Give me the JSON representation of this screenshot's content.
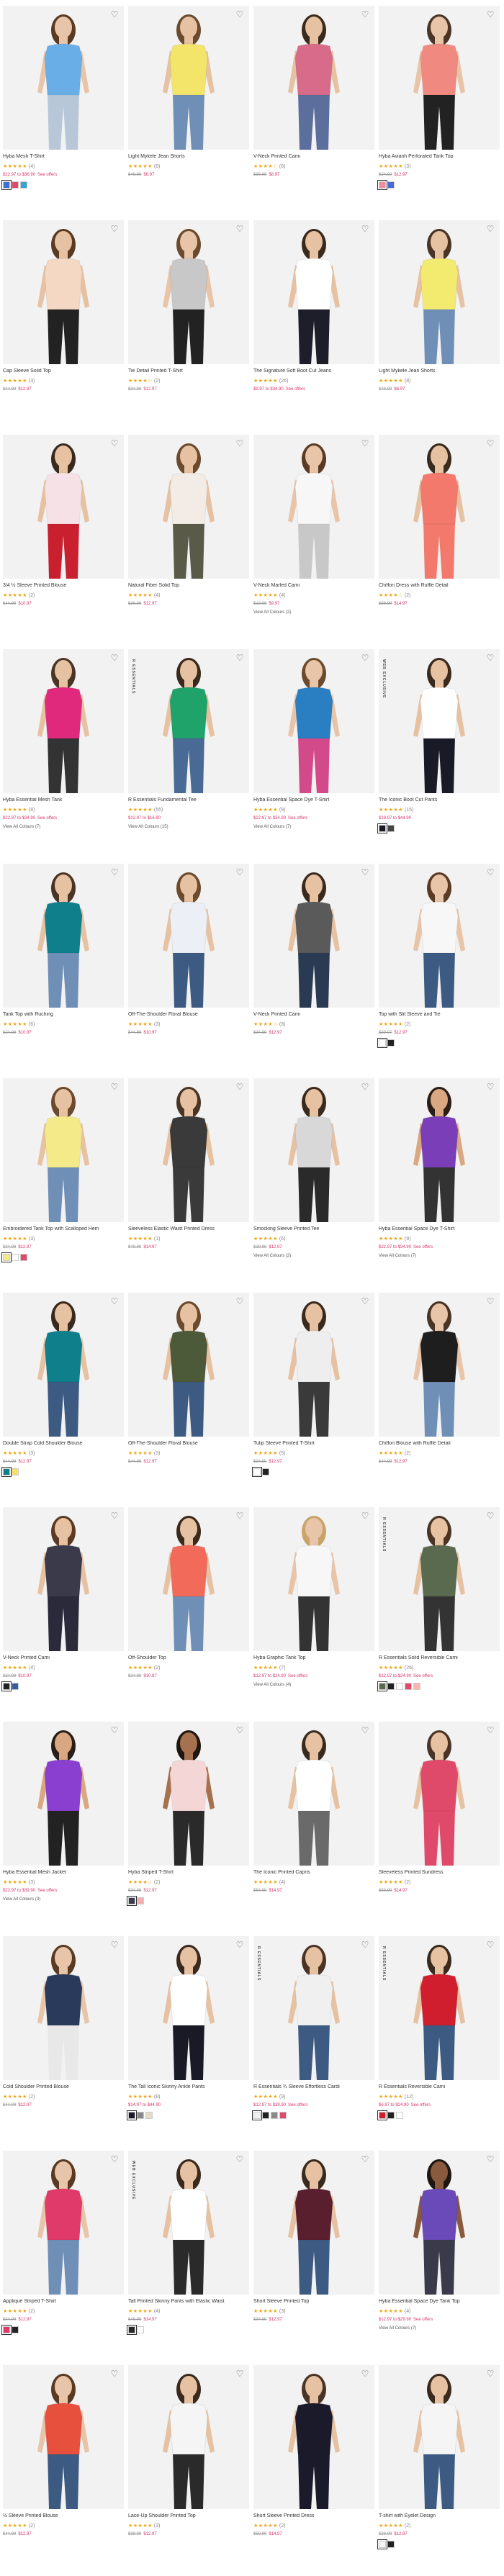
{
  "products": [
    {
      "name": "Hyba Mesh T-Shirt",
      "rating": "★★★★★",
      "count": "(4)",
      "reg": "",
      "sale": "$22.97 to $36.90",
      "offer": "See offers",
      "top": "#6aaee8",
      "bottom": "#b8c7d8",
      "hair": "#5a3a22",
      "skin": "#e8c4a8",
      "swatches": [
        "#3f6fd1",
        "#e04a6a",
        "#3aa3c9"
      ],
      "colors": "",
      "badge": ""
    },
    {
      "name": "Light Mykele Jean Shorts",
      "rating": "★★★★★",
      "count": "(8)",
      "reg": "$49.99",
      "sale": "$6.97",
      "offer": "",
      "top": "#f3e56a",
      "bottom": "#6f8fb7",
      "hair": "#6b4a2e",
      "skin": "#e6c2a2",
      "swatches": [],
      "colors": "",
      "badge": ""
    },
    {
      "name": "V-Neck Printed Cami",
      "rating": "★★★★☆",
      "count": "(6)",
      "reg": "$39.99",
      "sale": "$8.97",
      "offer": "",
      "top": "#d86a8a",
      "bottom": "#5c6f9c",
      "hair": "#3a2a1e",
      "skin": "#e6c2a2",
      "swatches": [],
      "colors": "",
      "badge": ""
    },
    {
      "name": "Hyba Avianh Perforated Tank Top",
      "rating": "★★★★★",
      "count": "(3)",
      "reg": "$24.99",
      "sale": "$12.97",
      "offer": "",
      "top": "#f08a80",
      "bottom": "#222222",
      "hair": "#4a3426",
      "skin": "#e8c4a8",
      "swatches": [
        "#ef8aa0",
        "#4a6ad0"
      ],
      "colors": "",
      "badge": ""
    },
    {
      "name": "Cap Sleeve Solid Top",
      "rating": "★★★★★",
      "count": "(3)",
      "reg": "$44.99",
      "sale": "$12.97",
      "offer": "",
      "top": "#f4d8c4",
      "bottom": "#222222",
      "hair": "#5a3a22",
      "skin": "#e6c2a2",
      "swatches": [],
      "colors": "",
      "badge": ""
    },
    {
      "name": "Tie Detail Printed T-Shirt",
      "rating": "★★★★☆",
      "count": "(2)",
      "reg": "$34.99",
      "sale": "$12.97",
      "offer": "",
      "top": "#c8c8c8",
      "bottom": "#222222",
      "hair": "#6b4a2e",
      "skin": "#e8c4a8",
      "swatches": [],
      "colors": "",
      "badge": ""
    },
    {
      "name": "The Signature Soft Boot Cut Jeans",
      "rating": "★★★★★",
      "count": "(26)",
      "reg": "",
      "sale": "$9.97 to $34.90",
      "offer": "See offers",
      "top": "#ffffff",
      "bottom": "#1e1e2a",
      "hair": "#3a2a1e",
      "skin": "#e6c2a2",
      "swatches": [],
      "colors": "",
      "badge": ""
    },
    {
      "name": "Light Mykele Jean Shorts",
      "rating": "★★★★★",
      "count": "(8)",
      "reg": "$49.99",
      "sale": "$6.97",
      "offer": "",
      "top": "#f3ea70",
      "bottom": "#6f8fb7",
      "hair": "#4a3426",
      "skin": "#e6c2a2",
      "swatches": [],
      "colors": "",
      "badge": ""
    },
    {
      "name": "3/4 ½ Sleeve Printed Blouse",
      "rating": "★★★★★",
      "count": "(2)",
      "reg": "$44.99",
      "sale": "$10.97",
      "offer": "",
      "top": "#f6e2e6",
      "bottom": "#c9202f",
      "hair": "#3a2a1e",
      "skin": "#e6c2a2",
      "swatches": [],
      "colors": "",
      "badge": ""
    },
    {
      "name": "Natural Fiber Solid Top",
      "rating": "★★★★★",
      "count": "(4)",
      "reg": "$39.99",
      "sale": "$12.97",
      "offer": "",
      "top": "#f3ece6",
      "bottom": "#5a5a48",
      "hair": "#6b4a2e",
      "skin": "#e6c2a2",
      "swatches": [],
      "colors": "",
      "badge": ""
    },
    {
      "name": "V-Neck Marled Cami",
      "rating": "★★★★★",
      "count": "(4)",
      "reg": "$19.99",
      "sale": "$9.97",
      "offer": "",
      "top": "#f7f7f7",
      "bottom": "#c8c8c8",
      "hair": "#5a3a22",
      "skin": "#e8c4a8",
      "swatches": [],
      "colors": "View All Colours (2)",
      "badge": ""
    },
    {
      "name": "Chiffon Dress with Ruffle Detail",
      "rating": "★★★★☆",
      "count": "(2)",
      "reg": "$59.99",
      "sale": "$14.97",
      "offer": "",
      "top": "#f2796c",
      "bottom": "#f2796c",
      "hair": "#3a2a1e",
      "skin": "#e6c2a2",
      "swatches": [],
      "colors": "",
      "badge": ""
    },
    {
      "name": "Hyba Essential Mesh Tank",
      "rating": "★★★★★",
      "count": "(8)",
      "reg": "",
      "sale": "$22.97 to $34.90",
      "offer": "See offers",
      "top": "#e0297d",
      "bottom": "#333333",
      "hair": "#4a3426",
      "skin": "#e6c2a2",
      "swatches": [],
      "colors": "View All Colours (7)",
      "badge": ""
    },
    {
      "name": "R Essentials Fundamental Tee",
      "rating": "★★★★★",
      "count": "(55)",
      "reg": "",
      "sale": "$12.97 to $16.90",
      "offer": "",
      "top": "#1fa36b",
      "bottom": "#4a6a96",
      "hair": "#3a2a1e",
      "skin": "#e6c2a2",
      "swatches": [],
      "colors": "View All Colours (15)",
      "badge": "R ESSENTIALS"
    },
    {
      "name": "Hyba Essential Space Dye T-Shirt",
      "rating": "★★★★★",
      "count": "(9)",
      "reg": "",
      "sale": "$22.97 to $34.90",
      "offer": "See offers",
      "top": "#2a7fc2",
      "bottom": "#d34a8a",
      "hair": "#6b4a2e",
      "skin": "#e8c4a8",
      "swatches": [],
      "colors": "View All Colours (7)",
      "badge": ""
    },
    {
      "name": "The Iconic Boot Cut Pants",
      "rating": "★★★★★",
      "count": "(15)",
      "reg": "",
      "sale": "$19.97 to $44.90",
      "offer": "",
      "top": "#ffffff",
      "bottom": "#1a1a26",
      "hair": "#3a2a1e",
      "skin": "#e6c2a2",
      "swatches": [
        "#1a1a26",
        "#444444"
      ],
      "colors": "",
      "badge": "WEB EXCLUSIVE"
    },
    {
      "name": "Tank Top with Ruching",
      "rating": "★★★★★",
      "count": "(6)",
      "reg": "$24.99",
      "sale": "$10.97",
      "offer": "",
      "top": "#0f7f8c",
      "bottom": "#6f8fb7",
      "hair": "#4a3426",
      "skin": "#e6c2a2",
      "swatches": [],
      "colors": "",
      "badge": ""
    },
    {
      "name": "Off-The-Shoulder Floral Blouse",
      "rating": "★★★★★",
      "count": "(3)",
      "reg": "$44.99",
      "sale": "$10.97",
      "offer": "",
      "top": "#eceff5",
      "bottom": "#3d5b82",
      "hair": "#6b4a2e",
      "skin": "#e6c2a2",
      "swatches": [],
      "colors": "",
      "badge": ""
    },
    {
      "name": "V-Neck Printed Cami",
      "rating": "★★★★☆",
      "count": "(8)",
      "reg": "$34.99",
      "sale": "$12.97",
      "offer": "",
      "top": "#5a5a5a",
      "bottom": "#2a3a52",
      "hair": "#3a2a1e",
      "skin": "#e6c2a2",
      "swatches": [],
      "colors": "",
      "badge": ""
    },
    {
      "name": "Top with Slit Sleeve and Tie",
      "rating": "★★★★★",
      "count": "(2)",
      "reg": "$39.97",
      "sale": "$12.97",
      "offer": "",
      "top": "#f7f7f7",
      "bottom": "#3d5b82",
      "hair": "#5a3a22",
      "skin": "#e8c4a8",
      "swatches": [
        "#ffffff",
        "#222222"
      ],
      "colors": "",
      "badge": ""
    },
    {
      "name": "Embroidered Tank Top with Scalloped Hem",
      "rating": "★★★★★",
      "count": "(3)",
      "reg": "$34.99",
      "sale": "$12.97",
      "offer": "",
      "top": "#f5ea8a",
      "bottom": "#6f8fb7",
      "hair": "#6b4a2e",
      "skin": "#e6c2a2",
      "swatches": [
        "#f5ea8a",
        "#ffffff",
        "#e04a6a"
      ],
      "colors": "",
      "badge": ""
    },
    {
      "name": "Sleeveless Elastic Waist Printed Dress",
      "rating": "★★★★★",
      "count": "(1)",
      "reg": "$49.99",
      "sale": "$14.97",
      "offer": "",
      "top": "#3a3a3a",
      "bottom": "#3a3a3a",
      "hair": "#4a3426",
      "skin": "#e6c2a2",
      "swatches": [],
      "colors": "",
      "badge": ""
    },
    {
      "name": "Smocking Sleeve Printed Tee",
      "rating": "★★★★★",
      "count": "(6)",
      "reg": "$39.99",
      "sale": "$12.97",
      "offer": "",
      "top": "#d8d8d8",
      "bottom": "#2a2a2a",
      "hair": "#3a2a1e",
      "skin": "#e6c2a2",
      "swatches": [],
      "colors": "View All Colours (2)",
      "badge": ""
    },
    {
      "name": "Hyba Essential Space Dye T-Shirt",
      "rating": "★★★★★",
      "count": "(9)",
      "reg": "",
      "sale": "$22.97 to $34.90",
      "offer": "See offers",
      "top": "#7a3fb8",
      "bottom": "#333333",
      "hair": "#2a1e16",
      "skin": "#d9a882",
      "swatches": [],
      "colors": "View All Colours (7)",
      "badge": ""
    },
    {
      "name": "Double Strap Cold Shoulder Blouse",
      "rating": "★★★★★",
      "count": "(3)",
      "reg": "$44.99",
      "sale": "$12.97",
      "offer": "",
      "top": "#0f7f8c",
      "bottom": "#3d5b82",
      "hair": "#3a2a1e",
      "skin": "#e6c2a2",
      "swatches": [
        "#0f7f8c",
        "#f5e06a"
      ],
      "colors": "",
      "badge": ""
    },
    {
      "name": "Off-The-Shoulder Floral Blouse",
      "rating": "★★★★★",
      "count": "(3)",
      "reg": "$44.99",
      "sale": "$12.97",
      "offer": "",
      "top": "#4c5a3a",
      "bottom": "#3d5b82",
      "hair": "#6b4a2e",
      "skin": "#e6c2a2",
      "swatches": [],
      "colors": "",
      "badge": ""
    },
    {
      "name": "Tulip Sleeve Printed T-Shirt",
      "rating": "★★★★★",
      "count": "(5)",
      "reg": "$34.99",
      "sale": "$12.97",
      "offer": "",
      "top": "#eeeeee",
      "bottom": "#3a3a3a",
      "hair": "#3a2a1e",
      "skin": "#e6c2a2",
      "swatches": [
        "#ffffff",
        "#222222"
      ],
      "colors": "",
      "badge": ""
    },
    {
      "name": "Chiffon Blouse with Ruffle Detail",
      "rating": "★★★★★",
      "count": "(2)",
      "reg": "$44.99",
      "sale": "$12.97",
      "offer": "",
      "top": "#1e1e1e",
      "bottom": "#6f8fb7",
      "hair": "#4a3426",
      "skin": "#e8c4a8",
      "swatches": [],
      "colors": "",
      "badge": ""
    },
    {
      "name": "V-Neck Printed Cami",
      "rating": "★★★★★",
      "count": "(4)",
      "reg": "$34.99",
      "sale": "$10.97",
      "offer": "",
      "top": "#3a3a4a",
      "bottom": "#2a2a3a",
      "hair": "#5a3a22",
      "skin": "#e6c2a2",
      "swatches": [
        "#222222",
        "#3a5a9a"
      ],
      "colors": "",
      "badge": ""
    },
    {
      "name": "Off-Shoulder Top",
      "rating": "★★★★★",
      "count": "(2)",
      "reg": "$34.99",
      "sale": "$10.97",
      "offer": "",
      "top": "#f26a5a",
      "bottom": "#6f8fb7",
      "hair": "#3a2a1e",
      "skin": "#e6c2a2",
      "swatches": [],
      "colors": "",
      "badge": ""
    },
    {
      "name": "Hyba Graphic Tank Top",
      "rating": "★★★★★",
      "count": "(7)",
      "reg": "",
      "sale": "$12.97 to $24.90",
      "offer": "See offers",
      "top": "#f7f7f7",
      "bottom": "#333333",
      "hair": "#c9a46a",
      "skin": "#e8c4a8",
      "swatches": [],
      "colors": "View All Colours (4)",
      "badge": ""
    },
    {
      "name": "R Essentials Solid Reversible Cami",
      "rating": "★★★★★",
      "count": "(26)",
      "reg": "",
      "sale": "$12.97 to $24.90",
      "offer": "See offers",
      "top": "#5a6a4e",
      "bottom": "#333333",
      "hair": "#4a3426",
      "skin": "#e6c2a2",
      "swatches": [
        "#5a6a4e",
        "#222222",
        "#ffffff",
        "#e04a6a",
        "#f5b7b0"
      ],
      "colors": "",
      "badge": "R ESSENTIALS"
    },
    {
      "name": "Hyba Essential Mesh Jacket",
      "rating": "★★★★★",
      "count": "(3)",
      "reg": "",
      "sale": "$22.97 to $39.90",
      "offer": "See offers",
      "top": "#8a3fd0",
      "bottom": "#222222",
      "hair": "#2a1e16",
      "skin": "#d9a882",
      "swatches": [],
      "colors": "View All Colours (3)",
      "badge": ""
    },
    {
      "name": "Hyba Striped T-Shirt",
      "rating": "★★★★☆",
      "count": "(2)",
      "reg": "$34.99",
      "sale": "$12.97",
      "offer": "",
      "top": "#f4d6d6",
      "bottom": "#2a2a2a",
      "hair": "#1e1610",
      "skin": "#a6714e",
      "swatches": [
        "#3a3a4a",
        "#f4b0b0"
      ],
      "colors": "",
      "badge": ""
    },
    {
      "name": "The Iconic Printed Capris",
      "rating": "★★★★★",
      "count": "(4)",
      "reg": "$54.99",
      "sale": "$14.97",
      "offer": "",
      "top": "#ffffff",
      "bottom": "#6a6a6a",
      "hair": "#3a2a1e",
      "skin": "#e6c2a2",
      "swatches": [],
      "colors": "",
      "badge": ""
    },
    {
      "name": "Sleeveless Printed Sundress",
      "rating": "★★★★★",
      "count": "(2)",
      "reg": "$59.99",
      "sale": "$14.97",
      "offer": "",
      "top": "#e04a6a",
      "bottom": "#e04a6a",
      "hair": "#4a3426",
      "skin": "#e6c2a2",
      "swatches": [],
      "colors": "",
      "badge": ""
    },
    {
      "name": "Cold Shoulder Printed Blouse",
      "rating": "★★★★★",
      "count": "(2)",
      "reg": "$44.99",
      "sale": "$12.97",
      "offer": "",
      "top": "#2a3a5a",
      "bottom": "#e8e8e8",
      "hair": "#5a3a22",
      "skin": "#e8c4a8",
      "swatches": [],
      "colors": "",
      "badge": ""
    },
    {
      "name": "The Tall Iconic Skinny Ankle Pants",
      "rating": "★★★★★",
      "count": "(8)",
      "reg": "",
      "sale": "$14.97 to $44.90",
      "offer": "",
      "top": "#ffffff",
      "bottom": "#1a1a26",
      "hair": "#3a2a1e",
      "skin": "#e6c2a2",
      "swatches": [
        "#1a1a26",
        "#888888",
        "#e6dcc6"
      ],
      "colors": "",
      "badge": ""
    },
    {
      "name": "R Essentials ¾ Sleeve Effortless Cardi",
      "rating": "★★★★★",
      "count": "(9)",
      "reg": "",
      "sale": "$12.97 to $39.90",
      "offer": "See offers",
      "top": "#f0f0f0",
      "bottom": "#3d5b82",
      "hair": "#4a3426",
      "skin": "#e6c2a2",
      "swatches": [
        "#f0f0f0",
        "#222222",
        "#8a8a8a",
        "#e04a6a"
      ],
      "colors": "",
      "badge": "R ESSENTIALS"
    },
    {
      "name": "R Essentials Reversible Cami",
      "rating": "★★★★★",
      "count": "(12)",
      "reg": "",
      "sale": "$6.97 to $24.90",
      "offer": "See offers",
      "top": "#d01e2e",
      "bottom": "#3d5b82",
      "hair": "#3a2a1e",
      "skin": "#e6c2a2",
      "swatches": [
        "#d01e2e",
        "#222222",
        "#ffffff"
      ],
      "colors": "",
      "badge": "R ESSENTIALS"
    },
    {
      "name": "Appliqué Striped T-Shirt",
      "rating": "★★★★★",
      "count": "(2)",
      "reg": "$34.99",
      "sale": "$12.97",
      "offer": "",
      "top": "#e03a6a",
      "bottom": "#6f8fb7",
      "hair": "#5a3a22",
      "skin": "#e8c4a8",
      "swatches": [
        "#e03a6a",
        "#222222"
      ],
      "colors": "",
      "badge": ""
    },
    {
      "name": "Tall Printed Skinny Pants with Elastic Waist",
      "rating": "★★★★★",
      "count": "(4)",
      "reg": "$49.99",
      "sale": "$14.97",
      "offer": "",
      "top": "#ffffff",
      "bottom": "#2a2a2a",
      "hair": "#3a2a1e",
      "skin": "#e6c2a2",
      "swatches": [
        "#2a2a2a",
        "#ffffff"
      ],
      "colors": "",
      "badge": "WEB EXCLUSIVE"
    },
    {
      "name": "Short Sleeve Printed Top",
      "rating": "★★★★★",
      "count": "(3)",
      "reg": "$34.99",
      "sale": "$12.97",
      "offer": "",
      "top": "#5a1f2e",
      "bottom": "#3d5b82",
      "hair": "#3a2a1e",
      "skin": "#e6c2a2",
      "swatches": [],
      "colors": "",
      "badge": ""
    },
    {
      "name": "Hyba Essential Space Dye Tank Top",
      "rating": "★★★★★",
      "count": "(4)",
      "reg": "",
      "sale": "$12.97 to $29.90",
      "offer": "See offers",
      "top": "#6a4ab8",
      "bottom": "#3a3a4a",
      "hair": "#1e1610",
      "skin": "#8a5a3e",
      "swatches": [],
      "colors": "View All Colours (7)",
      "badge": ""
    },
    {
      "name": "½ Sleeve Printed Blouse",
      "rating": "★★★★★",
      "count": "(2)",
      "reg": "$44.99",
      "sale": "$12.97",
      "offer": "",
      "top": "#e8503e",
      "bottom": "#3d5b82",
      "hair": "#5a3a22",
      "skin": "#e8c4a8",
      "swatches": [],
      "colors": "",
      "badge": ""
    },
    {
      "name": "Lace-Up Shoulder Printed Top",
      "rating": "★★★★★",
      "count": "(3)",
      "reg": "$39.99",
      "sale": "$12.97",
      "offer": "",
      "top": "#f5f5f5",
      "bottom": "#2a2a2a",
      "hair": "#3a2a1e",
      "skin": "#e6c2a2",
      "swatches": [],
      "colors": "",
      "badge": ""
    },
    {
      "name": "Short Sleeve Printed Dress",
      "rating": "★★★★★",
      "count": "(2)",
      "reg": "$59.99",
      "sale": "$14.97",
      "offer": "",
      "top": "#1a1a2a",
      "bottom": "#1a1a2a",
      "hair": "#4a3426",
      "skin": "#e6c2a2",
      "swatches": [],
      "colors": "",
      "badge": ""
    },
    {
      "name": "T-shirt with Eyelet Design",
      "rating": "★★★★★",
      "count": "(2)",
      "reg": "$39.99",
      "sale": "$12.97",
      "offer": "",
      "top": "#f5f5f5",
      "bottom": "#3d5b82",
      "hair": "#3a2a1e",
      "skin": "#e6c2a2",
      "swatches": [
        "#f5f5f5",
        "#222222"
      ],
      "colors": "",
      "badge": ""
    }
  ]
}
